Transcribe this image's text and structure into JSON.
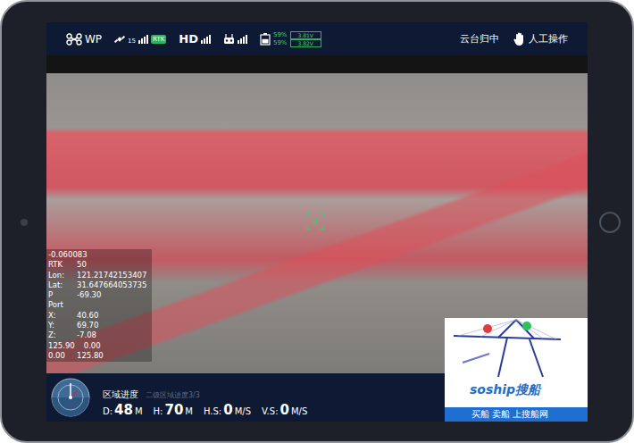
{
  "top_bar": {
    "mode": "WP",
    "satellites": "15",
    "rtk": "RTK",
    "video": "HD",
    "gps_signal": 1,
    "video_signal": 1,
    "remote_signal": 1,
    "battery_level": 0.59,
    "battery": [
      "59%",
      "59%"
    ],
    "voltages": [
      "3.81V",
      "3.82V"
    ],
    "gimbal": "云台归中",
    "control": "人工操作"
  },
  "telemetry": [
    [
      "-0.060083"
    ],
    [
      "RTK",
      "50"
    ],
    [
      "Lon:",
      "121.21742153407"
    ],
    [
      "Lat:",
      "31.647664053735"
    ],
    [
      "P",
      "-69.30"
    ],
    [
      "Port"
    ],
    [
      "X:",
      "40.60"
    ],
    [
      "Y:",
      "69.70"
    ],
    [
      "Z:",
      "-7.08"
    ],
    [
      "125.90",
      "0.00"
    ],
    [
      "0.00",
      "125.80"
    ]
  ],
  "bottom_bar": {
    "progress_label": "区域进度",
    "progress_value": "二级区域进度3/3",
    "stats": [
      {
        "label": "D:",
        "value": "48",
        "unit": "M"
      },
      {
        "label": "H:",
        "value": "70",
        "unit": "M"
      },
      {
        "label": "H.S:",
        "value": "0",
        "unit": "M/S"
      },
      {
        "label": "V.S:",
        "value": "0",
        "unit": "M/S"
      }
    ]
  },
  "inset": {
    "brand": "soship搜船",
    "slogan": "买船 卖船 上搜船网"
  }
}
